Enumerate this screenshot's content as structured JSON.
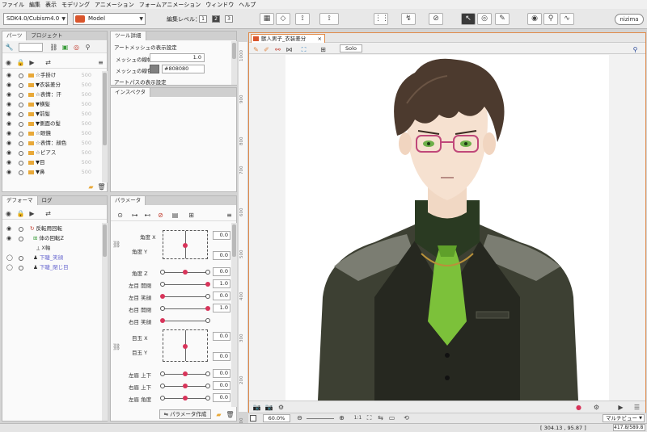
{
  "menu": [
    "ファイル",
    "編集",
    "表示",
    "モデリング",
    "アニメーション",
    "フォームアニメーション",
    "ウィンドウ",
    "ヘルプ"
  ],
  "toolbar": {
    "sdk_select": "SDK4.0/Cubism4.0",
    "model_select": "Model",
    "edit_level_label": "編集レベル：",
    "levels": [
      "1",
      "2",
      "3"
    ],
    "active_level": "2",
    "logo": "nizima"
  },
  "parts_panel": {
    "tabs": [
      "パーツ",
      "プロジェクト"
    ],
    "items": [
      {
        "label": "☆手掛け",
        "num": "500"
      },
      {
        "label": "▼衣装差分",
        "num": "500"
      },
      {
        "label": "☆表情：汗",
        "num": "500"
      },
      {
        "label": "▼横髪",
        "num": "500"
      },
      {
        "label": "▼前髪",
        "num": "500"
      },
      {
        "label": "▼側面の髪",
        "num": "500"
      },
      {
        "label": "☆眼鏡",
        "num": "500"
      },
      {
        "label": "☆表情：顔色",
        "num": "500"
      },
      {
        "label": "☆ピアス",
        "num": "500"
      },
      {
        "label": "▼目",
        "num": "500"
      },
      {
        "label": "▼鼻",
        "num": "500"
      }
    ]
  },
  "tool_detail": {
    "tab": "ツール詳細",
    "section1": "アートメッシュの表示設定",
    "mesh_width_label": "メッシュの線幅",
    "mesh_width_value": "1.0",
    "mesh_color_label": "メッシュの線色",
    "mesh_color_value": "#808080",
    "section2": "アートパスの表示設定"
  },
  "inspector": {
    "tab": "インスペクタ"
  },
  "deformer_panel": {
    "tabs": [
      "デフォーマ",
      "ログ"
    ],
    "items": [
      {
        "label": "反転用回転"
      },
      {
        "label": "体の回転Z"
      },
      {
        "label": "X軸"
      },
      {
        "label": "下睫_笑顔"
      },
      {
        "label": "下睫_閉じ目"
      }
    ]
  },
  "parameter_panel": {
    "tab": "パラメータ",
    "rows": [
      {
        "label": "角度 X",
        "value": "0.0"
      },
      {
        "label": "角度 Y",
        "value": "0.0"
      },
      {
        "label": "角度 Z",
        "value": "0.0"
      },
      {
        "label": "左目 開閉",
        "value": "1.0"
      },
      {
        "label": "左目 笑顔",
        "value": "0.0"
      },
      {
        "label": "右目 開閉",
        "value": "1.0"
      },
      {
        "label": "右目 笑顔",
        "value": "0.0"
      },
      {
        "label": "目玉 X",
        "value": "0.0"
      },
      {
        "label": "目玉 Y",
        "value": "0.0"
      },
      {
        "label": "左眉 上下",
        "value": "0.0"
      },
      {
        "label": "右眉 上下",
        "value": "0.0"
      },
      {
        "label": "左眉 角度",
        "value": "0.0"
      }
    ],
    "create_button": "パラメータ作成"
  },
  "viewport": {
    "tab_label": "獣人男子_衣装差分",
    "solo_button": "Solo",
    "ruler_ticks": [
      "100",
      "200",
      "300",
      "400",
      "500",
      "600",
      "700",
      "800",
      "900",
      "1000"
    ],
    "zoom": "60.0%",
    "view_select": "マルチビュー"
  },
  "status": {
    "coords": "[  304.13 ,   95.87  ]",
    "memory": "417.8/589.8"
  },
  "colors": {
    "accent": "#e08a4a",
    "knob": "#d8345a",
    "folder": "#e8a838"
  }
}
